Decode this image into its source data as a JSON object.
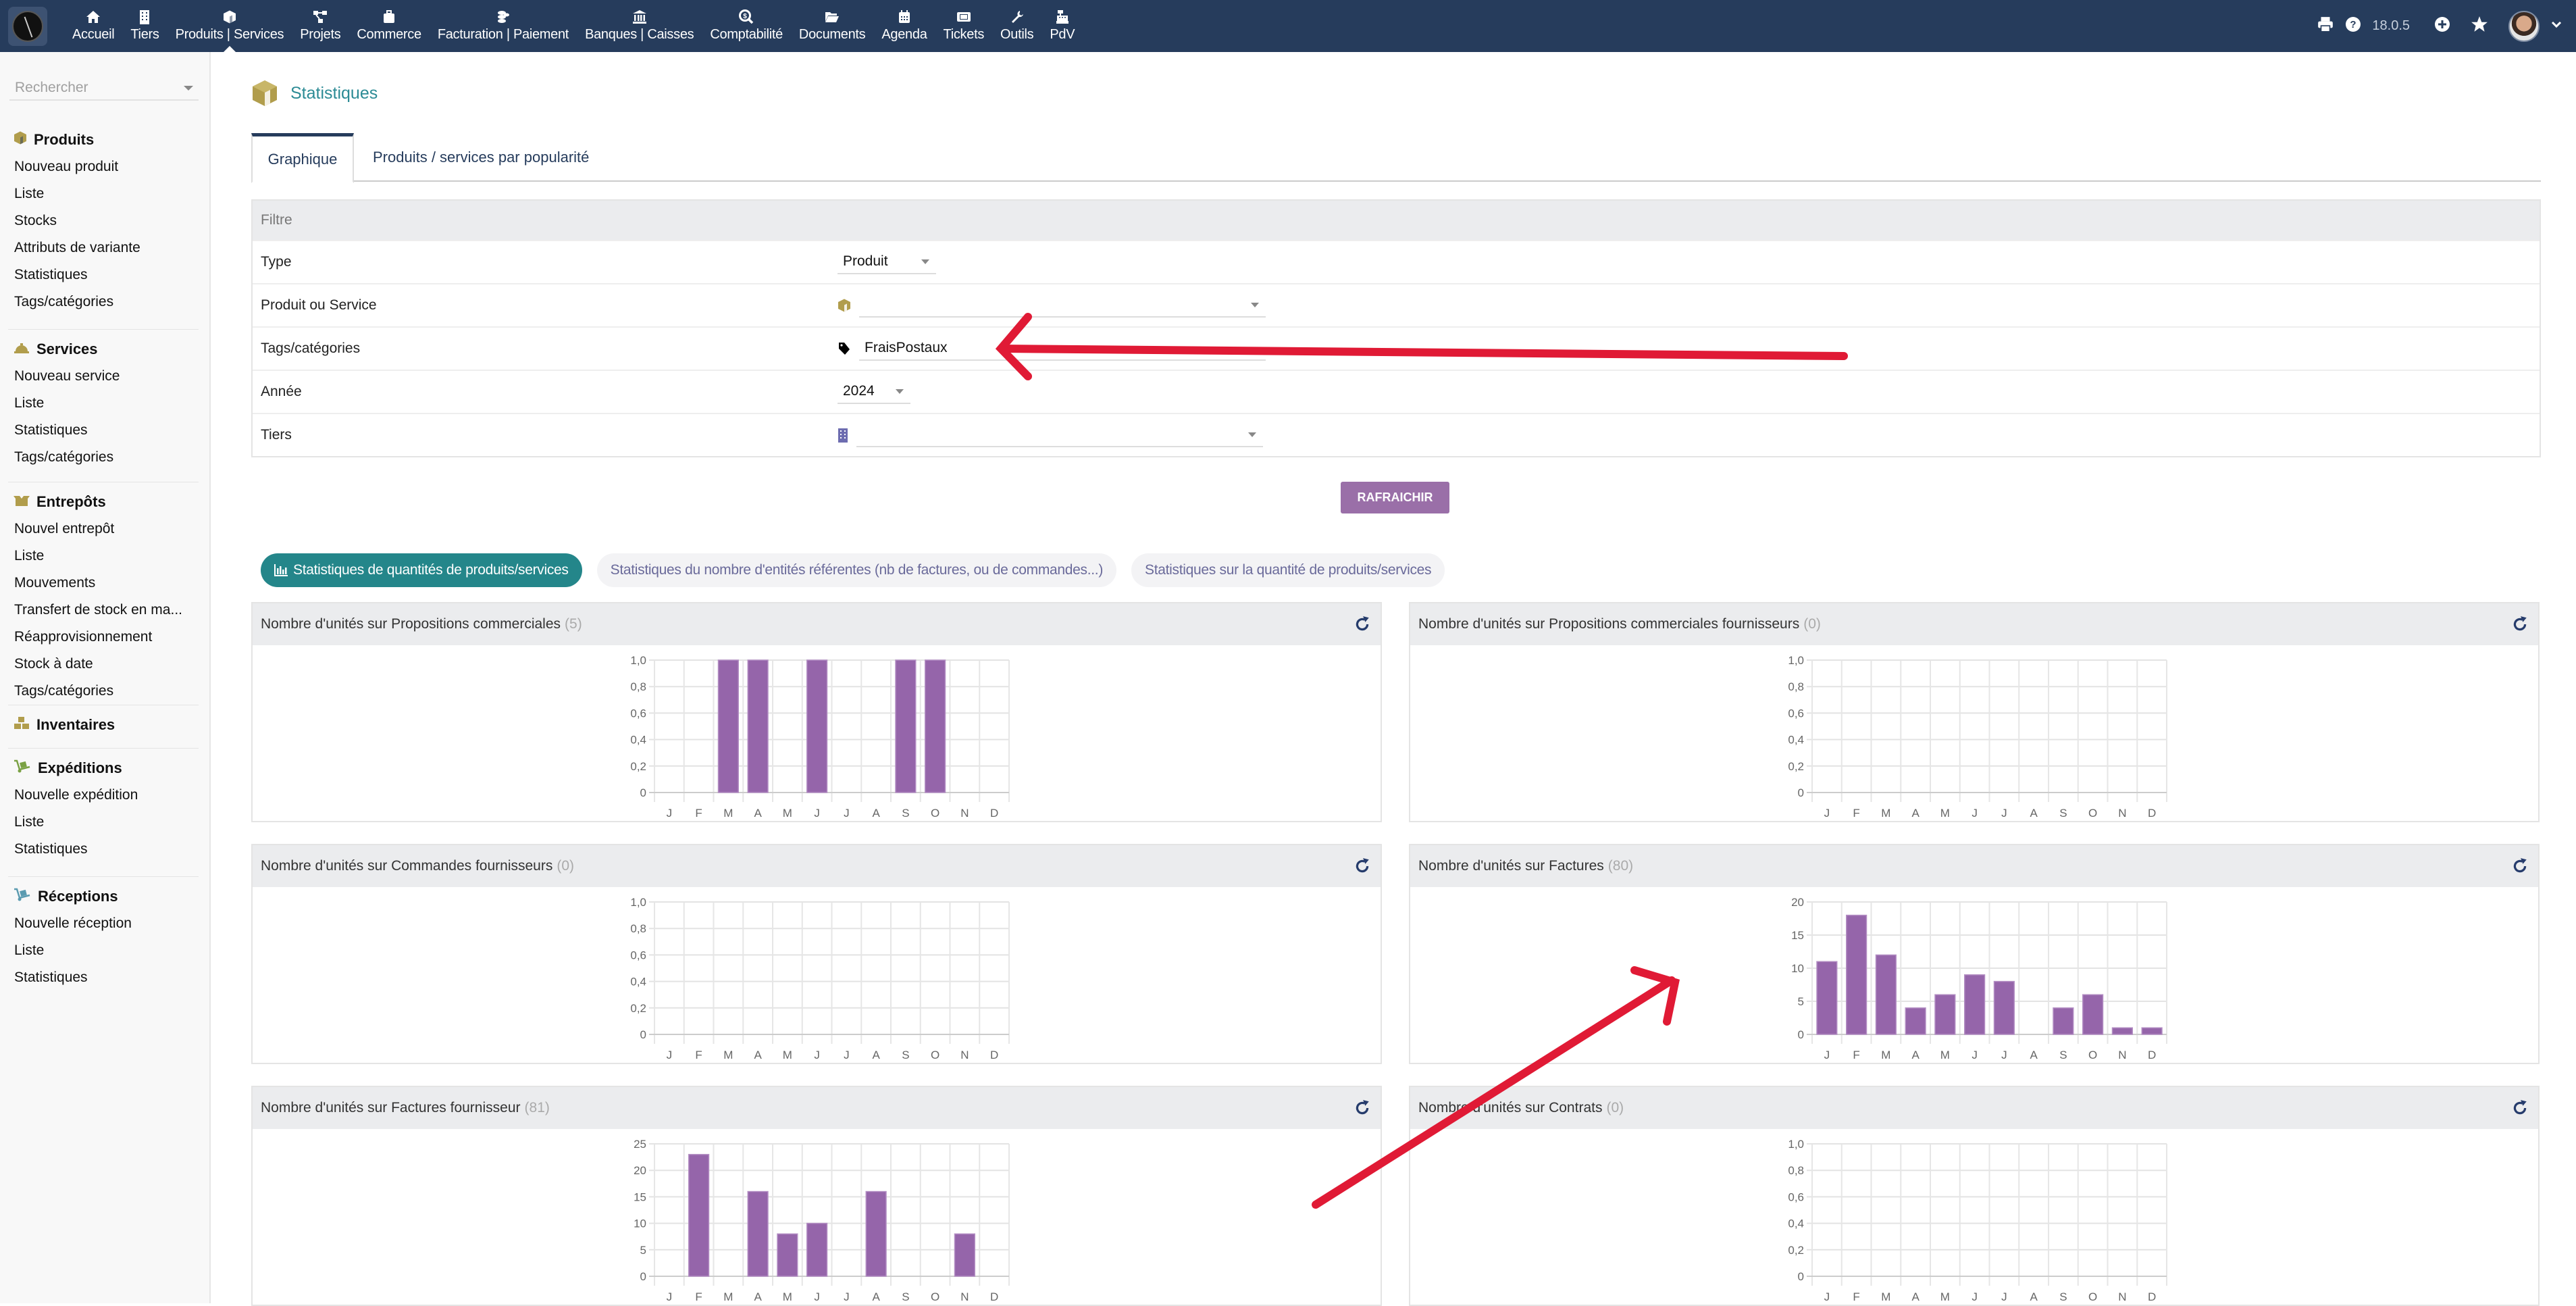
{
  "topbar": {
    "menu": [
      {
        "label": "Accueil",
        "icon": "home-icon"
      },
      {
        "label": "Tiers",
        "icon": "building-icon"
      },
      {
        "label": "Produits | Services",
        "icon": "cube-icon",
        "active": true
      },
      {
        "label": "Projets",
        "icon": "project-diagram-icon"
      },
      {
        "label": "Commerce",
        "icon": "suitcase-icon"
      },
      {
        "label": "Facturation | Paiement",
        "icon": "coins-icon"
      },
      {
        "label": "Banques | Caisses",
        "icon": "bank-icon"
      },
      {
        "label": "Comptabilité",
        "icon": "search-dollar-icon"
      },
      {
        "label": "Documents",
        "icon": "folder-open-icon"
      },
      {
        "label": "Agenda",
        "icon": "calendar-icon"
      },
      {
        "label": "Tickets",
        "icon": "ticket-icon"
      },
      {
        "label": "Outils",
        "icon": "wrench-icon"
      },
      {
        "label": "PdV",
        "icon": "cash-register-icon"
      }
    ],
    "version": "18.0.5"
  },
  "sidebar": {
    "search_placeholder": "Rechercher",
    "sections": [
      {
        "title": "Produits",
        "icon": "cube-icon",
        "links": [
          "Nouveau produit",
          "Liste",
          "Stocks",
          "Attributs de variante",
          "Statistiques",
          "Tags/catégories"
        ]
      },
      {
        "title": "Services",
        "icon": "concierge-bell-icon",
        "links": [
          "Nouveau service",
          "Liste",
          "Statistiques",
          "Tags/catégories"
        ]
      },
      {
        "title": "Entrepôts",
        "icon": "box-open-icon",
        "links": [
          "Nouvel entrepôt",
          "Liste",
          "Mouvements",
          "Transfert de stock en ma...",
          "Réapprovisionnement",
          "Stock à date",
          "Tags/catégories"
        ]
      },
      {
        "title": "Inventaires",
        "icon": "boxes-icon",
        "links": []
      },
      {
        "title": "Expéditions",
        "icon": "dolly-icon",
        "links": [
          "Nouvelle expédition",
          "Liste",
          "Statistiques"
        ]
      },
      {
        "title": "Réceptions",
        "icon": "dolly-icon",
        "links": [
          "Nouvelle réception",
          "Liste",
          "Statistiques"
        ]
      }
    ]
  },
  "page": {
    "title": "Statistiques",
    "tabs": [
      "Graphique",
      "Produits / services par popularité"
    ],
    "filter": {
      "heading": "Filtre",
      "rows": [
        {
          "label": "Type",
          "value": "Produit"
        },
        {
          "label": "Produit ou Service",
          "value": ""
        },
        {
          "label": "Tags/catégories",
          "value": "FraisPostaux"
        },
        {
          "label": "Année",
          "value": "2024"
        },
        {
          "label": "Tiers",
          "value": ""
        }
      ]
    },
    "refresh_label": "RAFRAICHIR",
    "stat_tabs": [
      "Statistiques de quantités de produits/services",
      "Statistiques du nombre d'entités référentes (nb de factures, ou de commandes...)",
      "Statistiques sur la quantité de produits/services"
    ]
  },
  "colors": {
    "bar": "#9565aa",
    "accent": "#24868a",
    "topbar": "#263c5c",
    "annotation": "#e01a35"
  },
  "chart_data": [
    {
      "type": "bar",
      "title": "Nombre d'unités sur Propositions commerciales",
      "count": "(5)",
      "categories": [
        "J",
        "F",
        "M",
        "A",
        "M",
        "J",
        "J",
        "A",
        "S",
        "O",
        "N",
        "D"
      ],
      "values": [
        0,
        0,
        1,
        1,
        0,
        1,
        0,
        0,
        1,
        1,
        0,
        0
      ],
      "ylim": [
        0,
        1
      ],
      "yticks": [
        "0",
        "0,2",
        "0,4",
        "0,6",
        "0,8",
        "1,0"
      ],
      "grid": true
    },
    {
      "type": "bar",
      "title": "Nombre d'unités sur Propositions commerciales fournisseurs",
      "count": "(0)",
      "categories": [
        "J",
        "F",
        "M",
        "A",
        "M",
        "J",
        "J",
        "A",
        "S",
        "O",
        "N",
        "D"
      ],
      "values": [
        0,
        0,
        0,
        0,
        0,
        0,
        0,
        0,
        0,
        0,
        0,
        0
      ],
      "ylim": [
        0,
        1
      ],
      "yticks": [
        "0",
        "0,2",
        "0,4",
        "0,6",
        "0,8",
        "1,0"
      ],
      "grid": true
    },
    {
      "type": "bar",
      "title": "Nombre d'unités sur Commandes fournisseurs",
      "count": "(0)",
      "categories": [
        "J",
        "F",
        "M",
        "A",
        "M",
        "J",
        "J",
        "A",
        "S",
        "O",
        "N",
        "D"
      ],
      "values": [
        0,
        0,
        0,
        0,
        0,
        0,
        0,
        0,
        0,
        0,
        0,
        0
      ],
      "ylim": [
        0,
        1
      ],
      "yticks": [
        "0",
        "0,2",
        "0,4",
        "0,6",
        "0,8",
        "1,0"
      ],
      "grid": true
    },
    {
      "type": "bar",
      "title": "Nombre d'unités sur Factures",
      "count": "(80)",
      "categories": [
        "J",
        "F",
        "M",
        "A",
        "M",
        "J",
        "J",
        "A",
        "S",
        "O",
        "N",
        "D"
      ],
      "values": [
        11,
        18,
        12,
        4,
        6,
        9,
        8,
        0,
        4,
        6,
        1,
        1
      ],
      "ylim": [
        0,
        20
      ],
      "yticks": [
        "0",
        "5",
        "10",
        "15",
        "20"
      ],
      "grid": true
    },
    {
      "type": "bar",
      "title": "Nombre d'unités sur Factures fournisseur",
      "count": "(81)",
      "categories": [
        "J",
        "F",
        "M",
        "A",
        "M",
        "J",
        "J",
        "A",
        "S",
        "O",
        "N",
        "D"
      ],
      "values": [
        0,
        23,
        0,
        16,
        8,
        10,
        0,
        16,
        0,
        0,
        8,
        0
      ],
      "ylim": [
        0,
        25
      ],
      "yticks": [
        "0",
        "5",
        "10",
        "15",
        "20",
        "25"
      ],
      "grid": true
    },
    {
      "type": "bar",
      "title": "Nombre d'unités sur Contrats",
      "count": "(0)",
      "categories": [
        "J",
        "F",
        "M",
        "A",
        "M",
        "J",
        "J",
        "A",
        "S",
        "O",
        "N",
        "D"
      ],
      "values": [
        0,
        0,
        0,
        0,
        0,
        0,
        0,
        0,
        0,
        0,
        0,
        0
      ],
      "ylim": [
        0,
        1
      ],
      "yticks": [
        "0",
        "0,2",
        "0,4",
        "0,6",
        "0,8",
        "1,0"
      ],
      "grid": true
    }
  ]
}
